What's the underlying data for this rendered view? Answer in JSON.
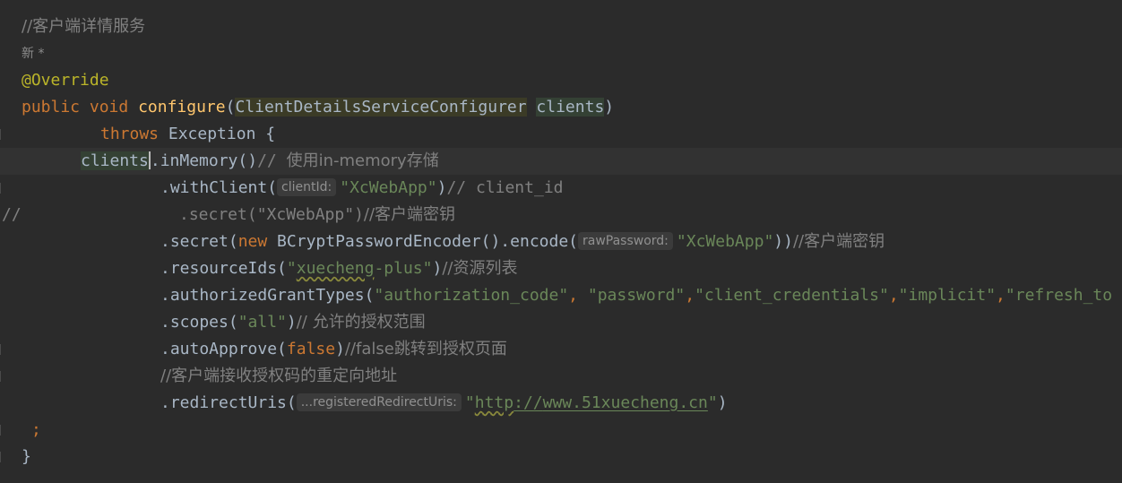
{
  "comment_title": "//客户端详情服务",
  "author_marker": "新 *",
  "annotation": "@Override",
  "decl": {
    "kw_public": "public",
    "kw_void": "void",
    "method": "configure",
    "paren_open": "(",
    "param_type": "ClientDetailsServiceConfigurer",
    "param_name": "clients",
    "paren_close": ")"
  },
  "throws_line": {
    "kw": "throws",
    "rest": " Exception {"
  },
  "in_memory": {
    "ref": "clients",
    "call": ".inMemory()",
    "comment_prefix": "// ",
    "comment_text": "使用in-memory存储"
  },
  "with_client": {
    "call": ".withClient(",
    "hint": "clientId:",
    "arg": "\"XcWebApp\"",
    "close": ")",
    "comment": "// client_id"
  },
  "commented_secret": {
    "marker": "//",
    "code": ".secret(\"XcWebApp\")",
    "comment": "//客户端密钥"
  },
  "secret": {
    "call": ".secret(",
    "kw_new": "new",
    "ctor": " BCryptPasswordEncoder().encode(",
    "hint": "rawPassword:",
    "arg": "\"XcWebApp\"",
    "close": "))",
    "comment": "//客户端密钥"
  },
  "resource_ids": {
    "call": ".resourceIds(",
    "q_open": "\"",
    "arg": "xuecheng",
    "arg_rest": "-plus\"",
    "close": ")",
    "comment": "//资源列表"
  },
  "grant_types": {
    "call": ".authorizedGrantTypes(",
    "a1": "\"authorization_code\"",
    "sep1": ", ",
    "a2": "\"password\"",
    "sep2": ",",
    "a3": "\"client_credentials\"",
    "sep3": ",",
    "a4": "\"implicit\"",
    "sep4": ",",
    "a5": "\"refresh_to"
  },
  "scopes": {
    "call": ".scopes(",
    "arg": "\"all\"",
    "close": ")",
    "comment": "// 允许的授权范围"
  },
  "auto_approve": {
    "call": ".autoApprove(",
    "kw": "false",
    "close": ")",
    "comment": "//false跳转到授权页面"
  },
  "redirect_comment": "//客户端接收授权码的重定向地址",
  "redirect": {
    "call": ".redirectUris(",
    "hint": "...registeredRedirectUris:",
    "q_open": "\"",
    "url_scheme": "http",
    "url_sep": "://",
    "url_host": "www.51xuecheng.cn",
    "q_close": "\"",
    "close": ")"
  },
  "semicolon": ";",
  "closing_brace": "}",
  "colors": {
    "background": "#2b2b2b",
    "keyword": "#cc7832",
    "annotation": "#bbb529",
    "method": "#ffc66d",
    "string": "#6a8759",
    "comment": "#808080",
    "text": "#a9b7c6"
  }
}
